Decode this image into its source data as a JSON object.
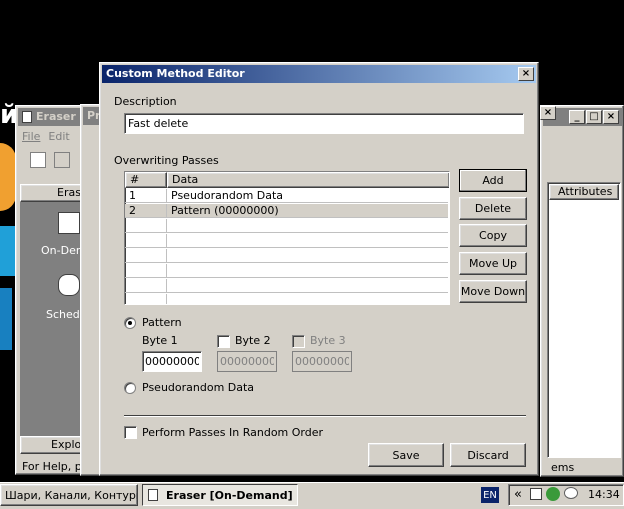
{
  "background_window": {
    "letter_fragment": "й",
    "title": "Eraser",
    "menu": [
      "File",
      "Edit"
    ],
    "header": "Erase",
    "items": [
      "On-Dem",
      "Schedu"
    ],
    "explorer_label": "Explor",
    "status_text": "For Help, pre",
    "second_title_fragment": "Pr",
    "attributes_header": "Attributes",
    "items_fragment": "ems"
  },
  "dialog": {
    "title": "Custom Method Editor",
    "description_label": "Description",
    "description_value": "Fast delete",
    "passes_label": "Overwriting Passes",
    "table": {
      "columns": [
        "#",
        "Data"
      ],
      "rows": [
        {
          "num": "1",
          "data": "Pseudorandom Data"
        },
        {
          "num": "2",
          "data": "Pattern (00000000)"
        }
      ]
    },
    "buttons": {
      "add": "Add",
      "delete": "Delete",
      "copy": "Copy",
      "move_up": "Move Up",
      "move_down": "Move Down",
      "save": "Save",
      "discard": "Discard"
    },
    "pattern_label": "Pattern",
    "byte1_label": "Byte 1",
    "byte1_value": "00000000",
    "byte2_label": "Byte 2",
    "byte2_value": "00000000",
    "byte3_label": "Byte 3",
    "byte3_value": "00000000",
    "pseudorandom_label": "Pseudorandom Data",
    "random_order_label": "Perform Passes In Random Order"
  },
  "taskbar": {
    "task1": "Шари, Канали, Контури, ...",
    "task2": "Eraser  [On-Demand]",
    "lang": "EN",
    "chevron": "«",
    "time": "14:34"
  },
  "colors": {
    "title_active_start": "#0a246a",
    "title_active_end": "#a6caf0",
    "title_inactive": "#808080",
    "face": "#d4d0c8",
    "selected_row": "#d4d0c8",
    "desktop_orange": "#f0a030",
    "desktop_cyan": "#20a0d8"
  }
}
